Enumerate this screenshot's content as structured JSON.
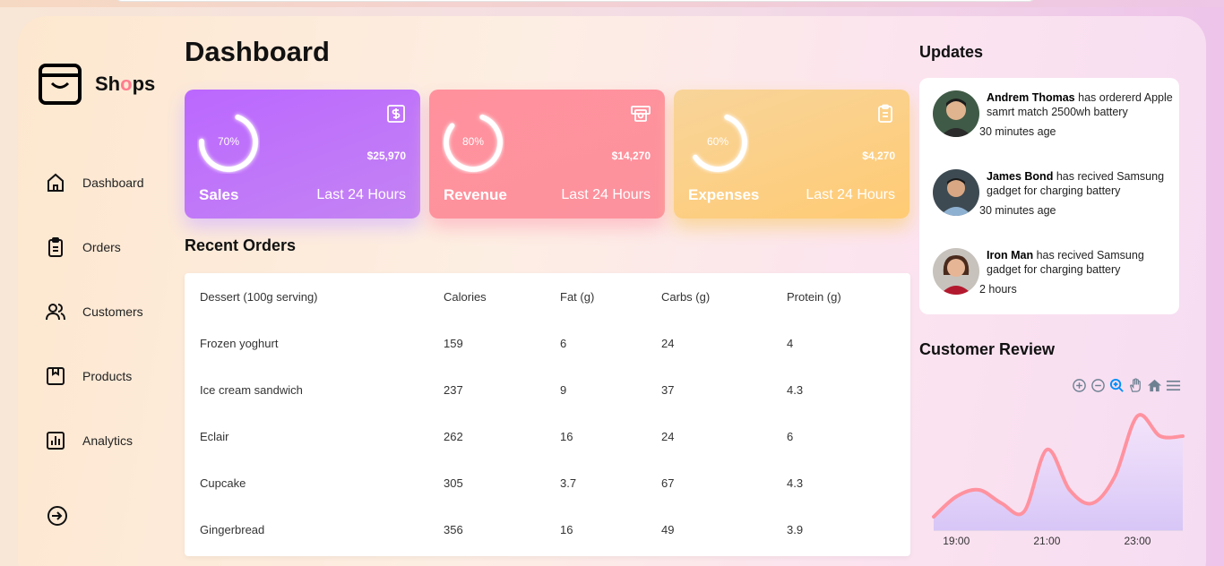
{
  "brand": {
    "name_pre": "Sh",
    "name_o": "o",
    "name_post": "ps",
    "accent": "#ff7c8e"
  },
  "sidebar": {
    "items": [
      {
        "label": "Dashboard",
        "icon": "home-icon"
      },
      {
        "label": "Orders",
        "icon": "clipboard-icon"
      },
      {
        "label": "Customers",
        "icon": "users-icon"
      },
      {
        "label": "Products",
        "icon": "package-icon"
      },
      {
        "label": "Analytics",
        "icon": "bar-chart-icon"
      }
    ],
    "logout_icon": "sign-out-icon"
  },
  "main": {
    "title": "Dashboard",
    "cards": [
      {
        "name": "Sales",
        "percent_label": "70%",
        "percent": 70,
        "value": "$25,970",
        "period": "Last 24 Hours",
        "icon": "dollar-icon"
      },
      {
        "name": "Revenue",
        "percent_label": "80%",
        "percent": 80,
        "value": "$14,270",
        "period": "Last 24 Hours",
        "icon": "money-icon"
      },
      {
        "name": "Expenses",
        "percent_label": "60%",
        "percent": 60,
        "value": "$4,270",
        "period": "Last 24 Hours",
        "icon": "clipboard-icon"
      }
    ],
    "recent_orders": {
      "title": "Recent Orders",
      "columns": [
        "Dessert (100g serving)",
        "Calories",
        "Fat (g)",
        "Carbs (g)",
        "Protein (g)"
      ],
      "rows": [
        [
          "Frozen yoghurt",
          "159",
          "6",
          "24",
          "4"
        ],
        [
          "Ice cream sandwich",
          "237",
          "9",
          "37",
          "4.3"
        ],
        [
          "Eclair",
          "262",
          "16",
          "24",
          "6"
        ],
        [
          "Cupcake",
          "305",
          "3.7",
          "67",
          "4.3"
        ],
        [
          "Gingerbread",
          "356",
          "16",
          "49",
          "3.9"
        ]
      ]
    }
  },
  "updates": {
    "title": "Updates",
    "items": [
      {
        "name": "Andrem Thomas",
        "text": " has ordererd Apple samrt match 2500wh battery",
        "time": "30 minutes age"
      },
      {
        "name": "James Bond",
        "text": " has recived Samsung gadget for charging battery",
        "time": "30 minutes age"
      },
      {
        "name": "Iron Man",
        "text": " has recived Samsung gadget for charging battery",
        "time": "2 hours"
      }
    ]
  },
  "review": {
    "title": "Customer Review",
    "toolbar": [
      "zoom-in-icon",
      "zoom-out-icon",
      "selection-zoom-icon",
      "pan-hand-icon",
      "reset-home-icon",
      "menu-icon"
    ]
  },
  "chart_data": {
    "type": "area",
    "x": [
      "18:30",
      "19:00",
      "19:30",
      "20:00",
      "20:30",
      "21:00",
      "21:30",
      "22:00",
      "22:30",
      "23:00",
      "23:30",
      "24:00"
    ],
    "values": [
      10,
      25,
      30,
      20,
      14,
      60,
      30,
      20,
      40,
      85,
      70,
      70
    ],
    "tick_labels": [
      "19:00",
      "21:00",
      "23:00"
    ],
    "title": "",
    "ylim": [
      0,
      100
    ],
    "line_color": "#ff929f",
    "fill_color": "#d7c6f7"
  }
}
